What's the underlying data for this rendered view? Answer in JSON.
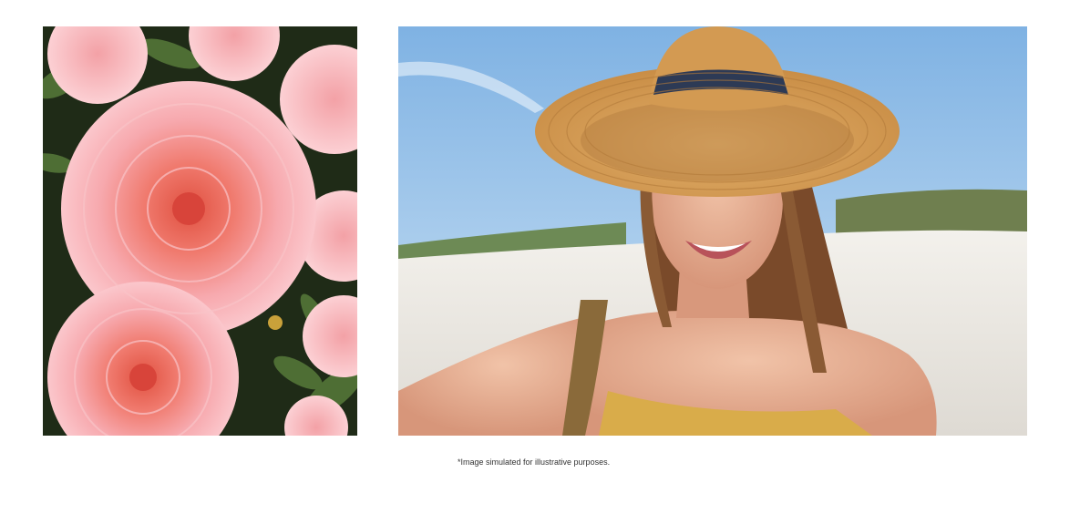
{
  "images": {
    "left": {
      "subject": "pink chrysanthemum flowers",
      "icon": "flower-photo"
    },
    "right": {
      "subject": "smiling woman in straw hat taking a selfie on a beach",
      "icon": "selfie-photo"
    }
  },
  "disclaimer": "*Image simulated for illustrative purposes.",
  "colors": {
    "petal": "#f5a3a8",
    "petal_center": "#e8695f",
    "leaf": "#3f5a2a",
    "sky": "#9cc8ec",
    "sand": "#ece8e1",
    "hat": "#d9a35e",
    "top": "#d9ac4a"
  }
}
